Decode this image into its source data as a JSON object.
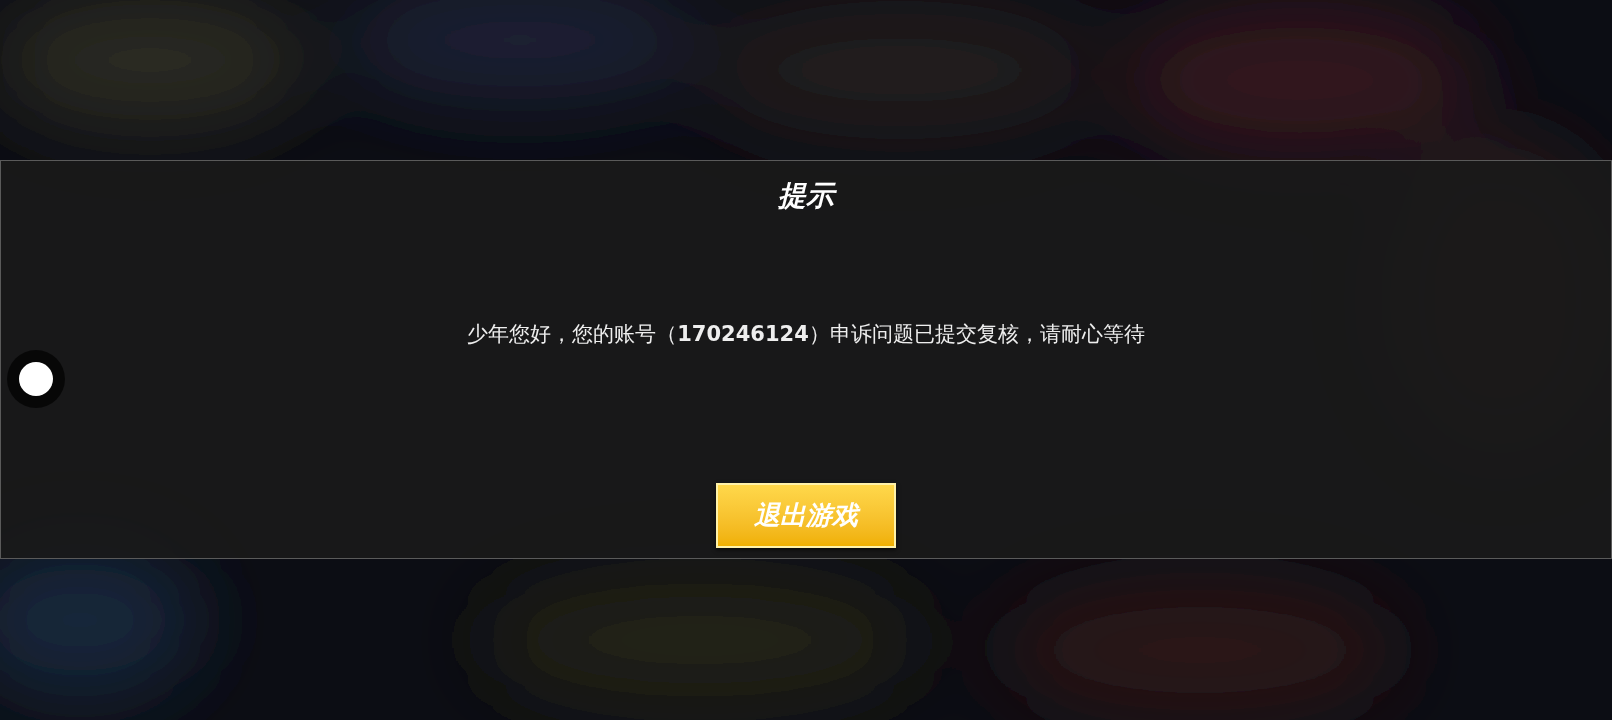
{
  "dialog": {
    "title": "提示",
    "message": "少年您好，您的账号（**170246124**）申诉问题已提交复核，请耐心等待",
    "button": "退出游戏"
  }
}
